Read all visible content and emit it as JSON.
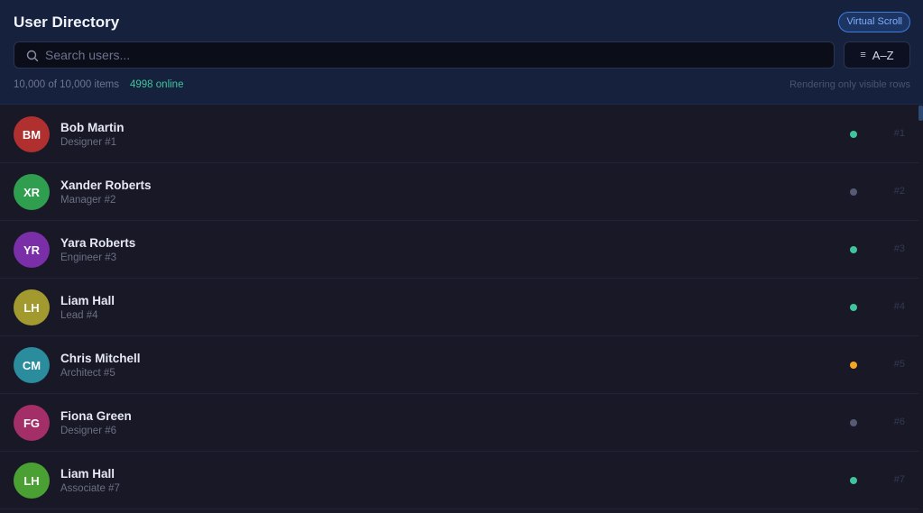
{
  "header": {
    "title": "User Directory",
    "badge": "Virtual Scroll",
    "search_placeholder": "Search users...",
    "sort_label": "A–Z",
    "sort_icon": "≡",
    "count_text": "10,000 of 10,000 items",
    "online_text": "4998 online",
    "hint_text": "Rendering only visible rows"
  },
  "colors": {
    "online": "#3ec59b",
    "offline": "#565b75",
    "away": "#f5a623"
  },
  "users": [
    {
      "initials": "BM",
      "name": "Bob Martin",
      "role": "Designer #1",
      "status": "online",
      "index": "#1",
      "color": "#b03030"
    },
    {
      "initials": "XR",
      "name": "Xander Roberts",
      "role": "Manager #2",
      "status": "offline",
      "index": "#2",
      "color": "#2f9e4f"
    },
    {
      "initials": "YR",
      "name": "Yara Roberts",
      "role": "Engineer #3",
      "status": "online",
      "index": "#3",
      "color": "#7a2fa8"
    },
    {
      "initials": "LH",
      "name": "Liam Hall",
      "role": "Lead #4",
      "status": "online",
      "index": "#4",
      "color": "#a29a2e"
    },
    {
      "initials": "CM",
      "name": "Chris Mitchell",
      "role": "Architect #5",
      "status": "away",
      "index": "#5",
      "color": "#2a8c9c"
    },
    {
      "initials": "FG",
      "name": "Fiona Green",
      "role": "Designer #6",
      "status": "offline",
      "index": "#6",
      "color": "#a42e68"
    },
    {
      "initials": "LH",
      "name": "Liam Hall",
      "role": "Associate #7",
      "status": "online",
      "index": "#7",
      "color": "#4aa032"
    }
  ]
}
